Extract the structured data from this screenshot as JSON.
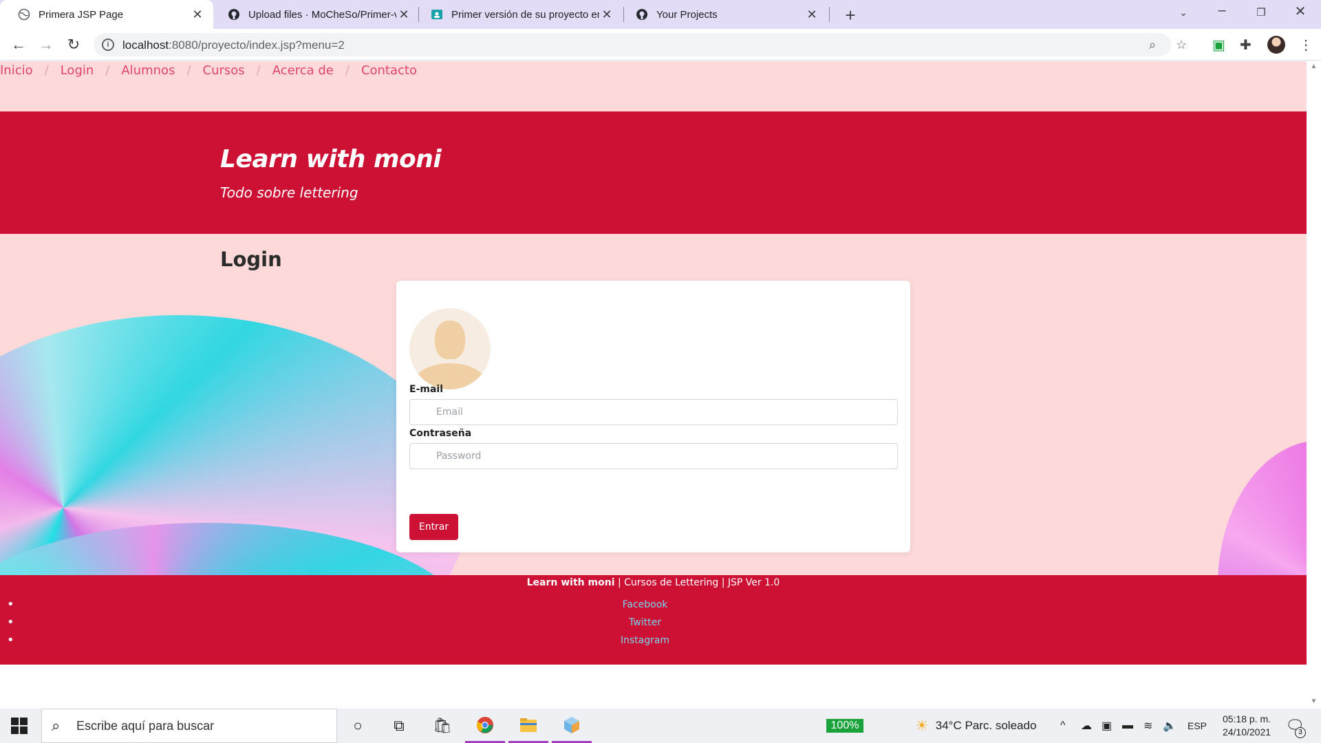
{
  "browser": {
    "tabs": [
      {
        "title": "Primera JSP Page",
        "icon": "globe-icon",
        "active": true
      },
      {
        "title": "Upload files · MoCheSo/Primer-v",
        "icon": "github-icon",
        "active": false
      },
      {
        "title": "Primer versión de su proyecto en",
        "icon": "classroom-icon",
        "active": false
      },
      {
        "title": "Your Projects",
        "icon": "github-icon",
        "active": false
      }
    ],
    "url_host": "localhost",
    "url_path": ":8080/proyecto/index.jsp?menu=2"
  },
  "site": {
    "breadcrumb": [
      "Inicio",
      "Login",
      "Alumnos",
      "Cursos",
      "Acerca de",
      "Contacto"
    ],
    "breadcrumb_separator": "/",
    "hero_title": "Learn with moni",
    "hero_subtitle": "Todo sobre lettering",
    "login_heading": "Login",
    "form": {
      "email_label": "E-mail",
      "email_placeholder": "Email",
      "password_label": "Contraseña",
      "password_placeholder": "Password",
      "submit_label": "Entrar"
    },
    "footer": {
      "brand": "Learn with moni",
      "rest": " | Cursos de Lettering | JSP Ver 1.0",
      "social": [
        "Facebook",
        "Twitter",
        "Instagram"
      ]
    }
  },
  "taskbar": {
    "search_placeholder": "Escribe aquí para buscar",
    "battery": "100%",
    "weather": "34°C  Parc. soleado",
    "language": "ESP",
    "time": "05:18 p. m.",
    "date": "24/10/2021",
    "notification_count": "3"
  },
  "colors": {
    "brand_red": "#cc1135",
    "page_pink": "#fdd9d9",
    "link_pink": "#e0436d",
    "footer_link": "#7ad3ea",
    "tabstrip": "#e3dcf7"
  }
}
